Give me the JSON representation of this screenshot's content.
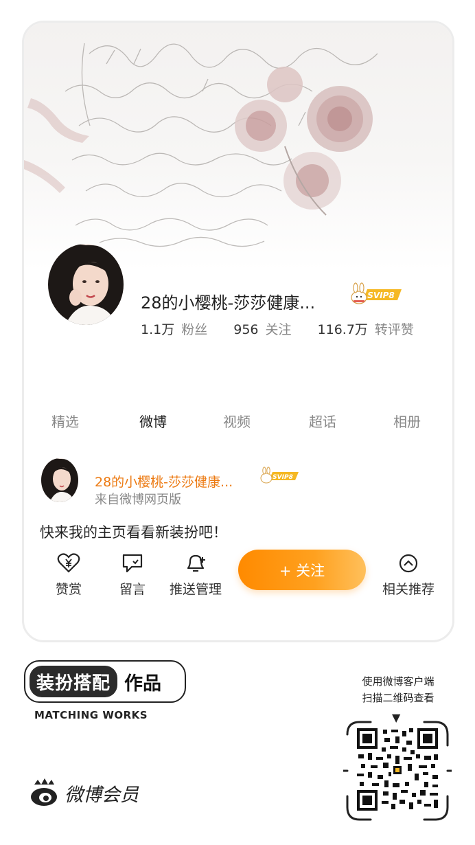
{
  "profile": {
    "name": "28的小樱桃-莎莎健康...",
    "vip_badge": "SVIP8",
    "stats": [
      {
        "value": "1.1万",
        "label": "粉丝"
      },
      {
        "value": "956",
        "label": "关注"
      },
      {
        "value": "116.7万",
        "label": "转评赞"
      }
    ]
  },
  "tabs": [
    "精选",
    "微博",
    "视频",
    "超话",
    "相册"
  ],
  "active_tab": "微博",
  "post": {
    "name": "28的小樱桃-莎莎健康...",
    "source": "来自微博网页版",
    "text": "快来我的主页看看新装扮吧！"
  },
  "actions": {
    "reward": "赞赏",
    "comment": "留言",
    "push": "推送管理",
    "follow": "+ 关注",
    "related": "相关推荐"
  },
  "footer": {
    "badge_dark": "装扮搭配",
    "badge_light": "作品",
    "badge_en": "MATCHING WORKS",
    "brand": "微博会员",
    "qr_hint_line1": "使用微博客户端",
    "qr_hint_line2": "扫描二维码查看",
    "qr_arrow": "▼"
  },
  "colors": {
    "accent": "#ff8a00",
    "name_orange": "#ec7a12",
    "gold": "#f5b823"
  },
  "icons": [
    "heart-yen-icon",
    "comment-icon",
    "bell-plus-icon",
    "chevron-up-circle-icon",
    "weibo-logo-icon",
    "qr-code-icon"
  ]
}
